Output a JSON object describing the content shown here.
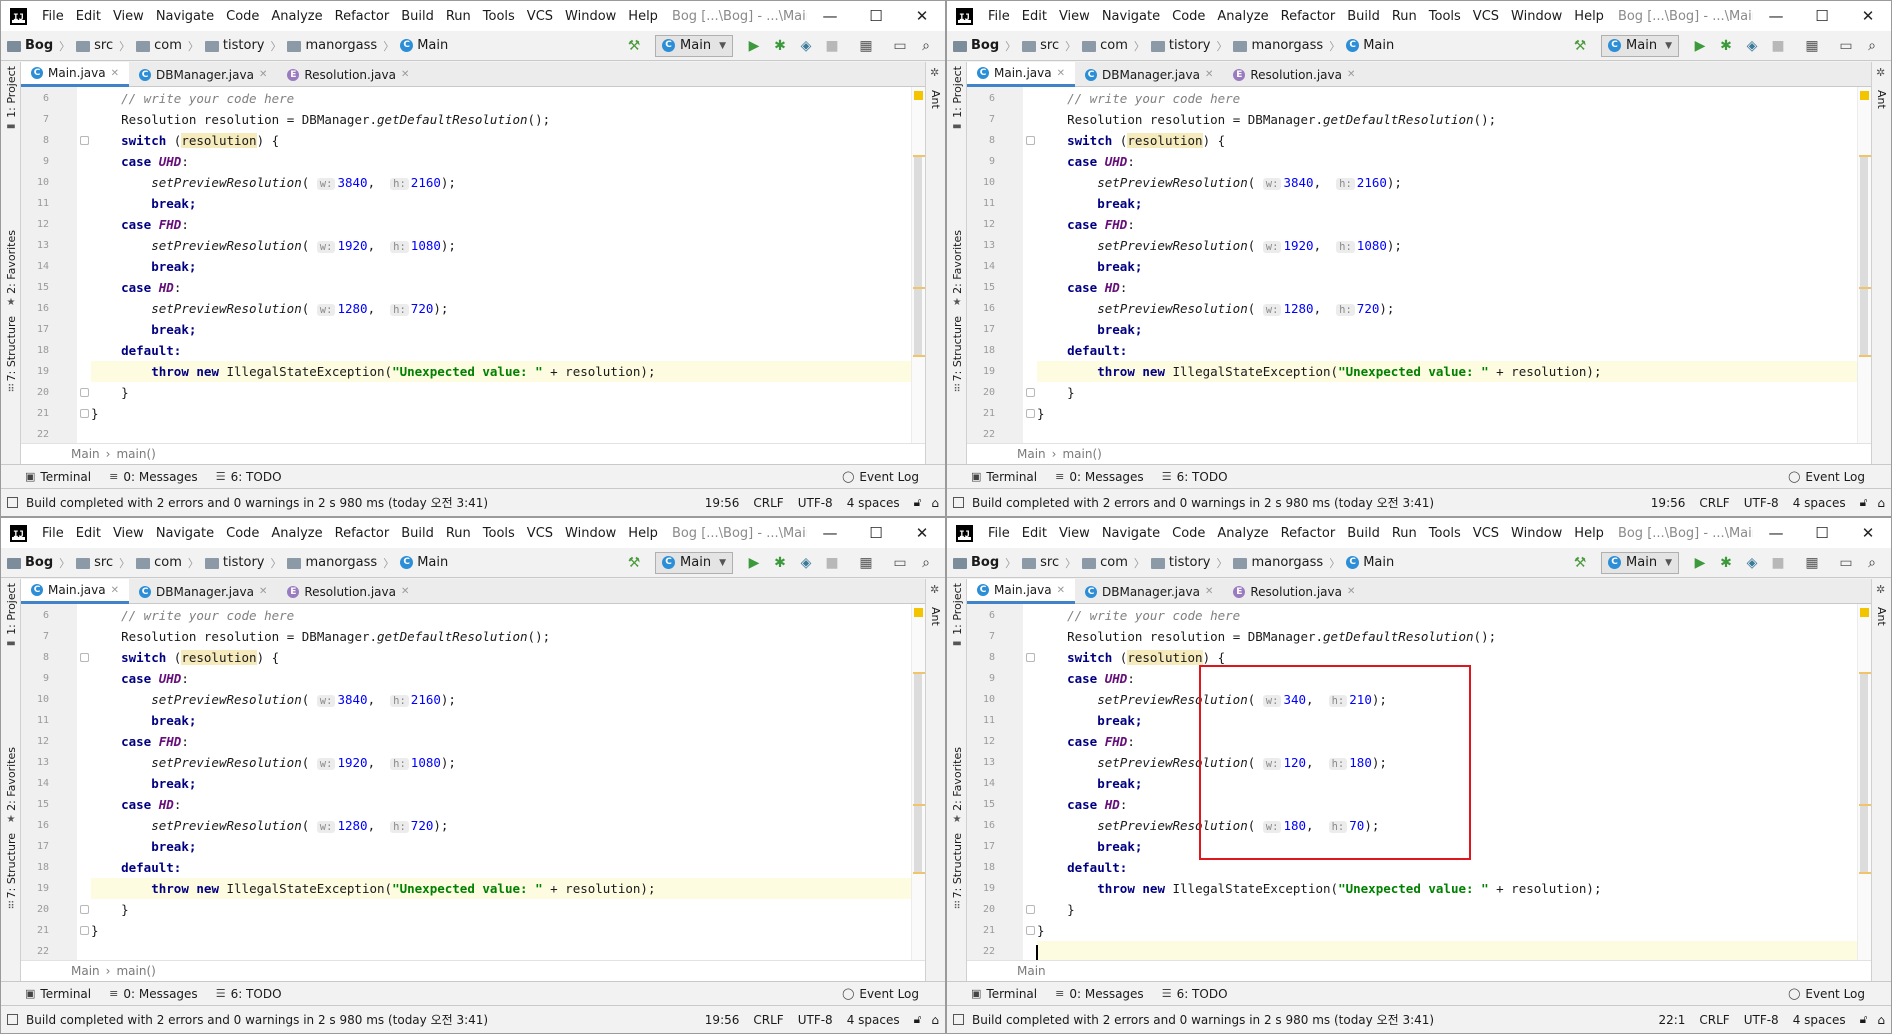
{
  "menus": [
    "File",
    "Edit",
    "View",
    "Navigate",
    "Code",
    "Analyze",
    "Refactor",
    "Build",
    "Run",
    "Tools",
    "VCS",
    "Window",
    "Help"
  ],
  "window_title": "Bog [...\\Bog] - ...\\Main.java",
  "window_controls": {
    "minimize": "—",
    "maximize": "☐",
    "close": "✕"
  },
  "breadcrumbs": [
    "Bog",
    "src",
    "com",
    "tistory",
    "manorgass",
    "Main"
  ],
  "run_config": "Main",
  "tabs": [
    "Main.java",
    "DBManager.java",
    "Resolution.java"
  ],
  "left_tool_tabs": {
    "project": "1: Project",
    "favorites": "2: Favorites",
    "structure": "7: Structure"
  },
  "right_tool_tab": "Ant",
  "code_breadcrumb": {
    "class_name": "Main",
    "method_name": "main()"
  },
  "tool_windows": {
    "terminal": "Terminal",
    "messages": "0: Messages",
    "todo": "6: TODO",
    "event_log": "Event Log"
  },
  "status": {
    "build_message": "Build completed with 2 errors and 0 warnings in 2 s 980 ms (today 오전 3:41)",
    "line_ending": "CRLF",
    "encoding": "UTF-8",
    "indent": "4 spaces"
  },
  "code": {
    "comment": "// write your code here",
    "decl_type": "Resolution",
    "decl_var": "resolution",
    "decl_eq": "=",
    "decl_class": "DBManager",
    "decl_method": "getDefaultResolution",
    "switch_kw": "switch",
    "switch_var": "resolution",
    "case_kw": "case",
    "break_kw": "break;",
    "default_kw": "default:",
    "throw_kw": "throw",
    "new_kw": "new",
    "exception": "IllegalStateException",
    "exception_msg": "\"Unexpected value: \"",
    "exception_tail": " + resolution);",
    "call": "setPreviewResolution",
    "hint_w": "w:",
    "hint_h": "h:",
    "enum_uhd": "UHD",
    "enum_fhd": "FHD",
    "enum_hd": "HD"
  },
  "line_numbers": [
    "6",
    "7",
    "8",
    "9",
    "10",
    "11",
    "12",
    "13",
    "14",
    "15",
    "16",
    "17",
    "18",
    "19",
    "20",
    "21",
    "22"
  ],
  "panels": [
    {
      "cursor": "19:56",
      "values": {
        "uhd_w": "3840",
        "uhd_h": "2160",
        "fhd_w": "1920",
        "fhd_h": "1080",
        "hd_w": "1280",
        "hd_h": "720"
      }
    },
    {
      "cursor": "19:56",
      "values": {
        "uhd_w": "3840",
        "uhd_h": "2160",
        "fhd_w": "1920",
        "fhd_h": "1080",
        "hd_w": "1280",
        "hd_h": "720"
      }
    },
    {
      "cursor": "19:56",
      "values": {
        "uhd_w": "3840",
        "uhd_h": "2160",
        "fhd_w": "1920",
        "fhd_h": "1080",
        "hd_w": "1280",
        "hd_h": "720"
      }
    },
    {
      "cursor": "22:1",
      "values": {
        "uhd_w": "340",
        "uhd_h": "210",
        "fhd_w": "120",
        "fhd_h": "180",
        "hd_w": "180",
        "hd_h": "70"
      }
    }
  ],
  "colors": {
    "keyword": "#000080",
    "string": "#008000",
    "number": "#0000ff",
    "enum_constant": "#660e7a",
    "highlight_box": "#e0161d",
    "tab_accent": "#4083c9"
  }
}
